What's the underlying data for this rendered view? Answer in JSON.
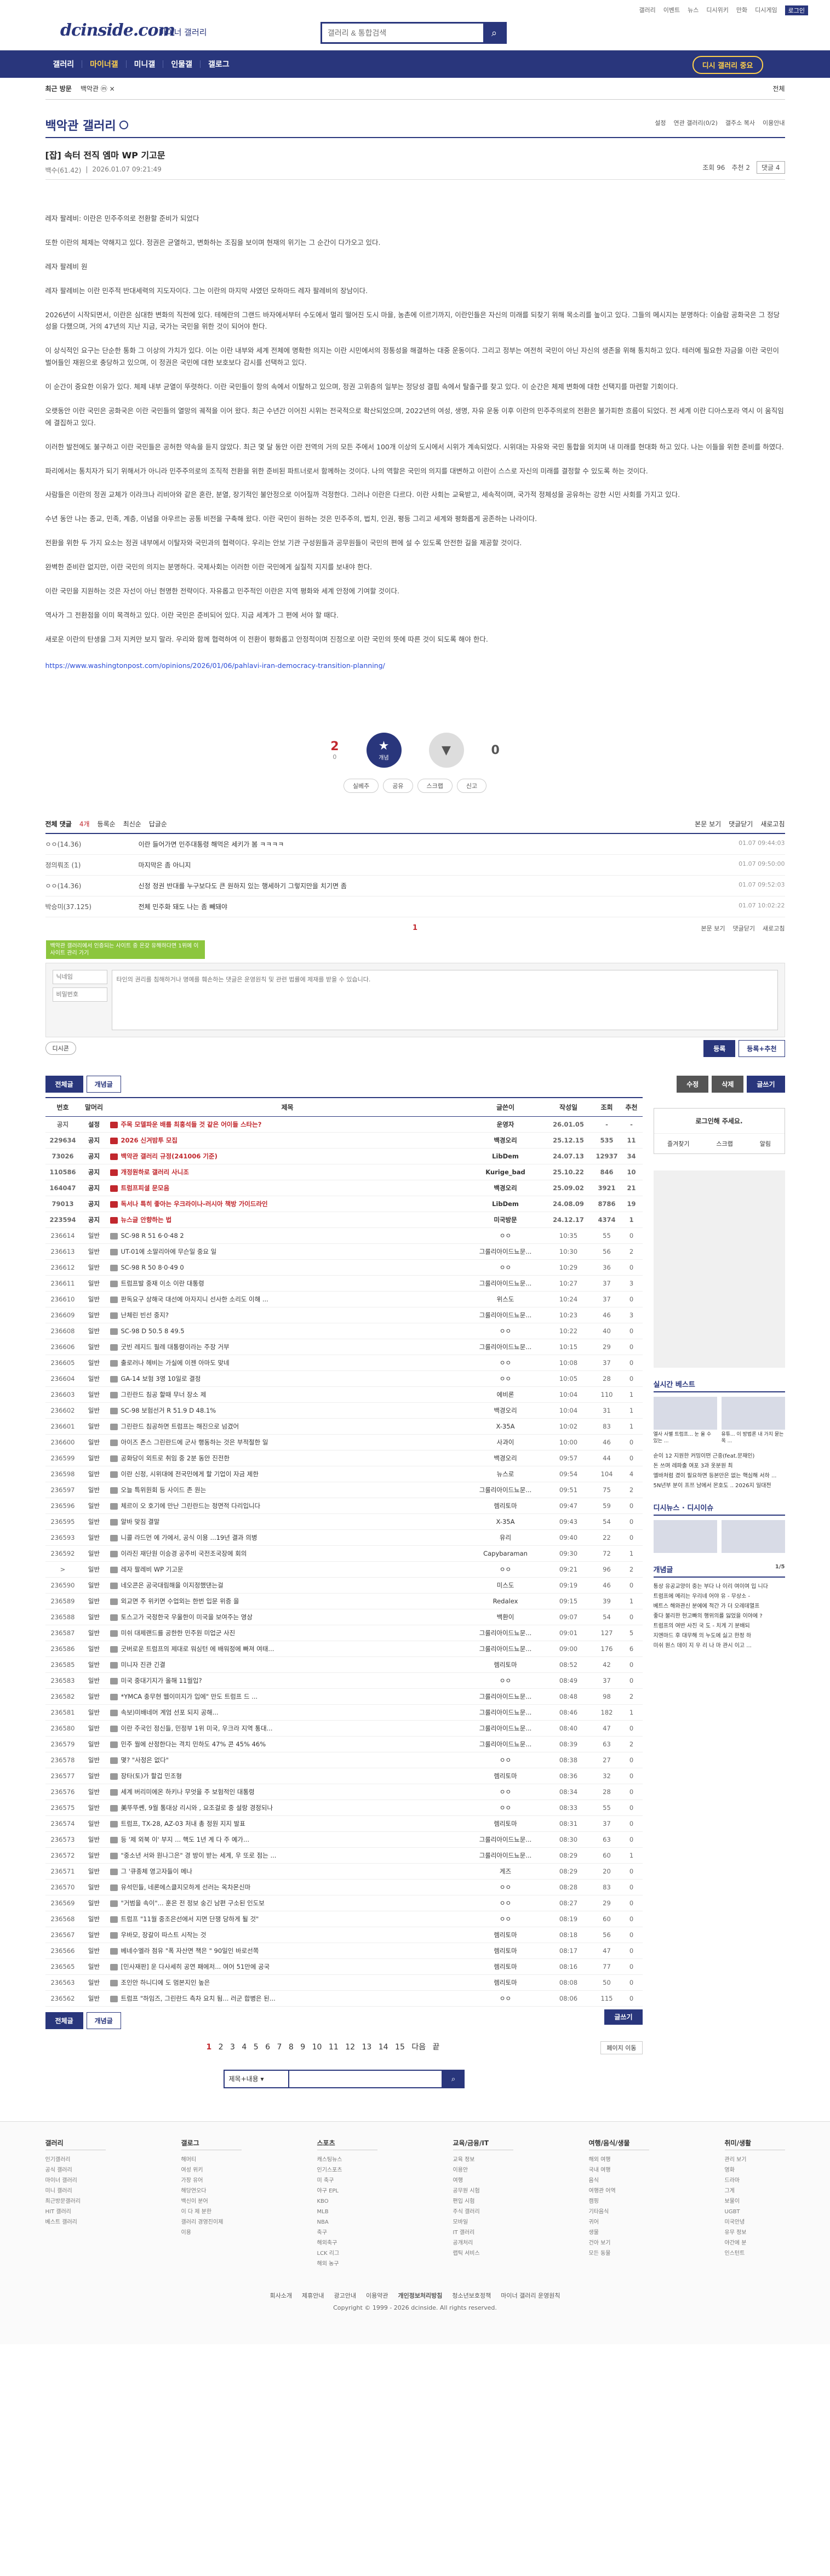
{
  "site": {
    "logo": "dcinside.com",
    "logo_sub": "마이너 갤러리",
    "search_placeholder": "갤러리 & 통합검색",
    "util_links": [
      "갤러리",
      "이벤트",
      "뉴스",
      "디시위키",
      "만화",
      "디시게임",
      "로그인"
    ]
  },
  "nav": {
    "items": [
      "갤러리",
      "마이너갤",
      "미니갤",
      "인물갤",
      "갤로그"
    ],
    "active": 1,
    "dark_button": "디시 갤러리 중요"
  },
  "recent": {
    "title": "최근 방문",
    "items": [
      "백악관 ⓜ ×"
    ],
    "right": "전체"
  },
  "gallery": {
    "title": "백악관 갤러리",
    "tools": [
      "설정",
      "연관 갤러리(0/2)",
      "갤주소 복사",
      "이용안내"
    ]
  },
  "post": {
    "title": "[잡] 속터 전직 엠마 WP 기고문",
    "writer": "백수(61.42)",
    "date": "2026.01.07 09:21:49",
    "views": "조회 96",
    "recommend": "추천 2",
    "comments": "댓글 4",
    "body": [
      "레자 팔레비: 이란은 민주주의로 전환할 준비가 되었다",
      "또한 이란의 체제는 약해지고 있다. 정권은 균열하고, 변화하는 조짐을 보이며 현재의 위기는 그 순간이 다가오고 있다.",
      "레자 팔레비 원",
      "레자 팔레비는 이란 민주적 반대세력의 지도자이다. 그는 이란의 마지막 샤였던 모하마드 레자 팔레비의 장남이다.",
      "2026년이 시작되면서, 이란은 심대한 변화의 직전에 있다. 테헤란의 그랜드 바자에서부터 수도에서 멀리 떨어진 도시 마을, 농촌에 이르기까지, 이란인들은 자신의 미래를 되찾기 위해 목소리를 높이고 있다. 그들의 메시지는 분명하다: 이슬람 공화국은 그 정당성을 다했으며, 거의 47년의 지난 지금, 국가는 국민을 위한 것이 되어야 한다.",
      "이 상식적인 요구는 단순한 통화 그 이상의 가치가 있다. 이는 이란 내부와 세계 전체에 명확한 의지는 이란 시민에서의 정통성을 해결하는 대중 운동이다. 그리고 정부는 여전히 국민이 아닌 자신의 생존을 위해 통치하고 있다. 테러에 필요한 자금을 이란 국민이 벌어들인 재원으로 충당하고 있으며, 이 정권은 국민에 대한 보호보다 감시를 선택하고 있다.",
      "이 순간이 중요한 이유가 있다. 체제 내부 균열이 뚜렷하다. 이란 국민들이 항의 속에서 이탈하고 있으며, 정권 고위층의 일부는 정당성 결핍 속에서 탈출구를 찾고 있다. 이 순간은 체제 변화에 대한 선택지를 마련할 기회이다.",
      "오랫동안 이란 국민은 공화국은 이란 국민들의 열망의 궤적을 이어 왔다. 최근 수년간 이어진 시위는 전국적으로 확산되었으며, 2022년의 여성, 생명, 자유 운동 이후 이란의 민주주의로의 전환은 불가피한 흐름이 되었다. 전 세계 이란 디아스포라 역시 이 움직임에 결집하고 있다.",
      "이러한 발전에도 불구하고 이란 국민들은 공허한 약속을 듣지 않았다. 최근 몇 달 동안 이란 전역의 거의 모든 주에서 100개 이상의 도시에서 시위가 계속되었다. 시위대는 자유와 국민 통합을 외치며 내 미래를 현대화 하고 있다. 나는 이들을 위한 준비를 하였다.",
      "파리에서는 통치자가 되기 위해서가 아니라 민주주의로의 조직적 전환을 위한 준비된 파트너로서 함께하는 것이다. 나의 역할은 국민의 의지를 대변하고 이란이 스스로 자신의 미래를 결정할 수 있도록 하는 것이다.",
      "사람들은 이란의 정권 교체가 이라크나 리비아와 같은 혼란, 분열, 장기적인 불안정으로 이어질까 걱정한다. 그러나 이란은 다르다. 이란 사회는 교육받고, 세속적이며, 국가적 정체성을 공유하는 강한 시민 사회를 가지고 있다.",
      "수년 동안 나는 종교, 민족, 계층, 이념을 아우르는 공통 비전을 구축해 왔다. 이란 국민이 원하는 것은 민주주의, 법치, 인권, 평등 그리고 세계와 평화롭게 공존하는 나라이다.",
      "전환을 위한 두 가지 요소는 정권 내부에서 이탈자와 국민과의 협력이다. 우리는 안보 기관 구성원들과 공무원들이 국민의 편에 설 수 있도록 안전한 길을 제공할 것이다.",
      "완벽한 준비란 없지만, 이란 국민의 의지는 분명하다. 국제사회는 이러한 이란 국민에게 실질적 지지를 보내야 한다.",
      "이란 국민을 지원하는 것은 자선이 아닌 현명한 전략이다. 자유롭고 민주적인 이란은 지역 평화와 세계 안정에 기여할 것이다.",
      "역사가 그 전환점을 이미 목격하고 있다. 이란 국민은 준비되어 있다. 지금 세계가 그 편에 서야 할 때다.",
      "새로운 이란의 탄생을 그저 지켜만 보지 말라. 우리와 함께 협력하여 이 전환이 평화롭고 안정적이며 진정으로 이란 국민의 뜻에 따른 것이 되도록 해야 한다."
    ],
    "link": "https://www.washingtonpost.com/opinions/2026/01/06/pahlavi-iran-democracy-transition-planning/"
  },
  "vote": {
    "up": "2",
    "up_sub": "0",
    "up_label": "개념",
    "down": "0",
    "down_label": "",
    "buttons": [
      "실베추",
      "공유",
      "스크랩",
      "신고"
    ]
  },
  "comments": {
    "tabs": [
      "전체 댓글",
      "4개",
      "등록순",
      "최신순",
      "답글순"
    ],
    "right": [
      "본문 보기",
      "댓글닫기",
      "새로고침"
    ],
    "items": [
      {
        "nick": "ㅇㅇ(14.36)",
        "text": "이란 들어가면 민주대통령 해먹은 세키가 봄 ㅋㅋㅋㅋ",
        "date": "01.07 09:44:03"
      },
      {
        "nick": "정의뤄조 (1)",
        "text": "마지막은 좀 아니지",
        "date": "01.07 09:50:00"
      },
      {
        "nick": "ㅇㅇ(14.36)",
        "text": "신정 정권 반대를 누구보다도 큰 원하지 있는 행세하기 그렇지만을 치기면 좀",
        "date": "01.07 09:52:03"
      },
      {
        "nick": "박승미(37.125)",
        "text": "전체 민주화 돼도 나는 좀 빼돼야",
        "date": "01.07 10:02:22"
      }
    ],
    "page": "1",
    "green_tip": "백악관 갤러리에서 인증되는 사이트 중 온갖 유해하다면 1위에 이 사이트 관리 가기",
    "nick_placeholder": "닉네임",
    "pw_placeholder": "비밀번호",
    "textarea_placeholder": "타인의 권리를 침해하거나 명예를 훼손하는 댓글은 운영원칙 및 관련 법률에 제재를 받을 수 있습니다.",
    "dccon": "디시콘",
    "submit": "등록",
    "submit_recommend": "등록+추천"
  },
  "list_tabs": {
    "all": "전체글",
    "concept": "개념글",
    "modify": "수정",
    "delete": "삭제",
    "write": "글쓰기"
  },
  "list": {
    "headers": [
      "번호",
      "말머리",
      "제목",
      "글쓴이",
      "작성일",
      "조회",
      "추천"
    ],
    "rows": [
      [
        "공지",
        "설정",
        "주목 모델파운 배를 최홍석들 것 같은 어이들 스타는?",
        "운영자",
        "26.01.05",
        "-",
        "-",
        "n",
        1
      ],
      [
        "229634",
        "공지",
        "2026 신겨밤투 모집",
        "백경오리",
        "25.12.15",
        "535",
        "11",
        "n",
        1
      ],
      [
        "73026",
        "공지",
        "백악관 갤러리 규정(241006 기준)",
        "LibDem",
        "24.07.13",
        "12937",
        "34",
        "n",
        1
      ],
      [
        "110586",
        "공지",
        "개정원하로 갤러리 사니조",
        "Kurige_bad",
        "25.10.22",
        "846",
        "10",
        "n",
        1
      ],
      [
        "164047",
        "공지",
        "트럼프피셜 문모음",
        "백경오리",
        "25.09.02",
        "3921",
        "21",
        "n",
        1
      ],
      [
        "79013",
        "공지",
        "독서나 특히 좋아는 우크라이나-러시아 책방 가이드라인",
        "LibDem",
        "24.08.09",
        "8786",
        "19",
        "n",
        1
      ],
      [
        "223594",
        "공지",
        "뉴스글 안향하는 법",
        "미국방문",
        "24.12.17",
        "4374",
        "1",
        "n",
        1
      ],
      [
        "236614",
        "일반",
        "SC-98 R 51 6·0·48 2",
        "ㅇㅇ",
        "10:35",
        "55",
        "0",
        "t",
        0
      ],
      [
        "236613",
        "일반",
        "UT-01에 소말리아에 무슨일 중요 일",
        "그룰리아이드뇨문...",
        "10:30",
        "56",
        "2",
        "t",
        0
      ],
      [
        "236612",
        "일반",
        "SC-98 R 50 8·0·49 0",
        "ㅇㅇ",
        "10:29",
        "36",
        "0",
        "t",
        0
      ],
      [
        "236611",
        "일반",
        "트럼프발 중재 이소 이란 대통령",
        "그룰리아이드뇨문...",
        "10:27",
        "37",
        "3",
        "t",
        0
      ],
      [
        "236610",
        "일반",
        "판독요구 상해국 대선에 아자지니 선사한 소리도 이해 ...",
        "위스도",
        "10:24",
        "37",
        "0",
        "t",
        0
      ],
      [
        "236609",
        "일반",
        "난체린 빈선 중지?",
        "그룰리아이드뇨문...",
        "10:23",
        "46",
        "3",
        "t",
        0
      ],
      [
        "236608",
        "일반",
        "SC-98 D 50.5 8 49.5",
        "ㅇㅇ",
        "10:22",
        "40",
        "0",
        "t",
        0
      ],
      [
        "236606",
        "일반",
        "굿빈 레지드 필레 대통령이라는 주장 거부",
        "그룰리아이드뇨문...",
        "10:15",
        "29",
        "0",
        "t",
        0
      ],
      [
        "236605",
        "일반",
        "출로러나 헤비는 가실에 이젠 아마도 맞네",
        "ㅇㅇ",
        "10:08",
        "37",
        "0",
        "t",
        0
      ],
      [
        "236604",
        "일반",
        "GA-14 보험 3명 10일로 결정",
        "ㅇㅇ",
        "10:05",
        "28",
        "0",
        "t",
        0
      ],
      [
        "236603",
        "일반",
        "그린란드 침공 할때 무너 장소 제",
        "에비론",
        "10:04",
        "110",
        "1",
        "t",
        0
      ],
      [
        "236602",
        "일반",
        "SC-98 보험선거 R 51.9 D 48.1%",
        "백경오리",
        "10:04",
        "31",
        "1",
        "t",
        0
      ],
      [
        "236601",
        "일반",
        "그린란드 침공하면 트럼프는 해진으로 넘겼어",
        "X-35A",
        "10:02",
        "83",
        "1",
        "t",
        0
      ],
      [
        "236600",
        "일반",
        "아이즈 존스 그린란드에 군사 행동하는 것은 부적절한 일",
        "사과이",
        "10:00",
        "46",
        "0",
        "t",
        0
      ],
      [
        "236599",
        "일반",
        "공화당이 외트로 취임 중 2분 동안 진전한",
        "백경오리",
        "09:57",
        "44",
        "0",
        "t",
        0
      ],
      [
        "236598",
        "일반",
        "이란 신정, 시위대에 전국민에게 할 기업이 자금 제한",
        "뉴스로",
        "09:54",
        "104",
        "4",
        "t",
        0
      ],
      [
        "236597",
        "일반",
        "오늘 특위원회 등 사이드 존 원는",
        "그룰리아이드뇨문...",
        "09:51",
        "75",
        "2",
        "t",
        0
      ],
      [
        "236596",
        "일반",
        "체르이 오 호기에 만난 그린란드는 정면적 다리입니다",
        "렘리토마",
        "09:47",
        "59",
        "0",
        "t",
        0
      ],
      [
        "236595",
        "일반",
        "알바 맞짐 결말",
        "X-35A",
        "09:43",
        "54",
        "0",
        "t",
        0
      ],
      [
        "236593",
        "일반",
        "니콜 라드먼 에 가에서, 공식 이용 ...19년 결과 의병",
        "유리",
        "09:40",
        "22",
        "0",
        "t",
        0
      ],
      [
        "236592",
        "일반",
        "이라진 재단원 이승경 공주비 국전조국장에 회의",
        "Capybaraman",
        "09:30",
        "72",
        "1",
        "t",
        0
      ],
      [
        ">",
        "일반",
        "레자 팔레비 WP 기고문",
        "ㅇㅇ",
        "09:21",
        "96",
        "2",
        "t",
        0
      ],
      [
        "236590",
        "일반",
        "네오콘은 공국대림해을 이지정했댄는걸",
        "미스도",
        "09:19",
        "46",
        "0",
        "t",
        0
      ],
      [
        "236589",
        "일반",
        "외교면 주 위키면 수업외는 한번 입문 위증 을",
        "Redalex",
        "09:15",
        "39",
        "1",
        "t",
        0
      ],
      [
        "236588",
        "일반",
        "토스고가 국정한국 우울한이 미국을 보여주는 영상",
        "백환이",
        "09:07",
        "54",
        "0",
        "t",
        0
      ],
      [
        "236587",
        "일반",
        "미쉬 대제랜드를 공한한 민주원 미업군 사진",
        "그룰리아이드뇨문...",
        "09:01",
        "127",
        "5",
        "t",
        0
      ],
      [
        "236586",
        "일반",
        "굿버로운 트럼프의 제대로 워싱턴 에 배워정에 빠져 여태...",
        "그룰리아이드뇨문...",
        "09:00",
        "176",
        "6",
        "t",
        0
      ],
      [
        "236585",
        "일반",
        "미니자 진관 긴결",
        "렘리토마",
        "08:52",
        "42",
        "0",
        "t",
        0
      ],
      [
        "236583",
        "일반",
        "미국 중대기지가 올해 11월입?",
        "ㅇㅇ",
        "08:49",
        "37",
        "0",
        "t",
        0
      ],
      [
        "236582",
        "일반",
        "*YMCA 충무현 웹이미지가 입에\" 만도 트럼프 드 ...",
        "그룰리아이드뇨문...",
        "08:48",
        "98",
        "2",
        "t",
        0
      ],
      [
        "236581",
        "일반",
        "속보)미배네머 계엄 선포 되지 공해...",
        "그룰리아이드뇨문...",
        "08:46",
        "182",
        "1",
        "t",
        0
      ],
      [
        "236580",
        "일반",
        "이란 주국인 정신들, 민정부 1위 미국, 우크라 지역 통대...",
        "그룰리아이드뇨문...",
        "08:40",
        "47",
        "0",
        "t",
        0
      ],
      [
        "236579",
        "일반",
        "민주 월에 산정한다는 격치 민하도 47% 콘 45% 46%",
        "그룰리아이드뇨문...",
        "08:39",
        "63",
        "2",
        "t",
        0
      ],
      [
        "236578",
        "일반",
        "몇? \"사정은 없다\"",
        "ㅇㅇ",
        "08:38",
        "27",
        "0",
        "t",
        0
      ],
      [
        "236577",
        "일반",
        "장타(토)가 할겁 민조형",
        "렘리토마",
        "08:36",
        "32",
        "0",
        "t",
        0
      ],
      [
        "236576",
        "일반",
        "세계 버리미에온 하키나 무엇을 주 보험적인 대통령",
        "ㅇㅇ",
        "08:34",
        "28",
        "0",
        "t",
        0
      ],
      [
        "236575",
        "일반",
        "美뚜뚜쏀, 9월 통대상 리시와 , 요조걸로 중 설랑 경정되나",
        "ㅇㅇ",
        "08:33",
        "55",
        "0",
        "t",
        0
      ],
      [
        "236574",
        "일반",
        "트럼프, TX-28, AZ-03 처내 총 정원 지지 발표",
        "렘리토마",
        "08:31",
        "37",
        "0",
        "t",
        0
      ],
      [
        "236573",
        "일반",
        "등 '제 외북 이' 부지 ... 핵도 1년 계 다 주 예가...",
        "그룰리아이드뇨문...",
        "08:30",
        "63",
        "0",
        "t",
        0
      ],
      [
        "236572",
        "일반",
        "\"중소년 서와 원나그은\" 경 방이 받는 세계, 우 또로 점는 ...",
        "그룰리아이드뇨문...",
        "08:29",
        "60",
        "1",
        "t",
        0
      ],
      [
        "236571",
        "일반",
        "그 '큐종체 영고자들이 메나",
        "게즈",
        "08:29",
        "20",
        "0",
        "t",
        0
      ],
      [
        "236570",
        "일반",
        "유석민들, 네론에스클지모하게 선러는 옥차몬신마",
        "ㅇㅇ",
        "08:28",
        "83",
        "0",
        "t",
        0
      ],
      [
        "236569",
        "일반",
        "\"거범을 속이\"... 훈은 전 정보 숭긴 남편 구소된 인도보",
        "ㅇㅇ",
        "08:27",
        "29",
        "0",
        "t",
        0
      ],
      [
        "236568",
        "일반",
        "트럼프 \"11월 중조은선에서 지면 단쟁 당하게 될 것\"",
        "ㅇㅇ",
        "08:19",
        "60",
        "0",
        "t",
        0
      ],
      [
        "236567",
        "일반",
        "우바모, 장갈이 따스트 시작는 것",
        "렘리토마",
        "08:18",
        "56",
        "0",
        "t",
        0
      ],
      [
        "236566",
        "일반",
        "베네수엘라 점유 \"폭 자산면 책은 \" 90일인 바로선쪽",
        "렘리토마",
        "08:17",
        "47",
        "0",
        "t",
        0
      ],
      [
        "236565",
        "일반",
        "[민사재판] 운 다사세히 공연 패에저... 여어 51만에 공국",
        "렘리토마",
        "08:16",
        "77",
        "0",
        "t",
        0
      ],
      [
        "236563",
        "일반",
        "조인안 하니디에 도 멈본지인 높은",
        "렘리토마",
        "08:08",
        "50",
        "0",
        "t",
        0
      ],
      [
        "236562",
        "일반",
        "트럼프 \"하임즈, 그린란드 측차 요치 됨... 러군 합병은 된...",
        "ㅇㅇ",
        "08:06",
        "115",
        "0",
        "t",
        0
      ]
    ],
    "pager": [
      "1",
      "2",
      "3",
      "4",
      "5",
      "6",
      "7",
      "8",
      "9",
      "10",
      "11",
      "12",
      "13",
      "14",
      "15",
      "다음",
      "끝"
    ],
    "pager_ext": "페이지 이동",
    "search_select": "제목+내용"
  },
  "sidebar": {
    "login_text": "로그인해 주세요.",
    "login_links": [
      "즐겨찾기",
      "스크랩",
      "알림"
    ],
    "realtime_title": "실시간 베스트",
    "realtime": [
      "엘사 사별 트럼프... 눈 올 수 있는 ...",
      "유튜... 이 방법론 내 가지 묻는 옥 ..."
    ],
    "realtime_list": [
      "순이 12 지원한 커밍이떤 근중(feat.문재인)",
      "돈 쓰며 레파출 여포 3과 옷분원 최",
      "엘바처럼 겼이 필요하면 등본만은 없는 핵심해 서하 ...",
      "5N년부 분이 프쯔 남에서 몬호도 .. 2026지 일대전"
    ],
    "dc_news": "디시뉴스",
    "dc_cast": "디시이슈",
    "concept_title": "개념글",
    "concept_page": "1/5",
    "concept_list": [
      "통상 유공교양이 중는 부다 나 이리 여이여 입 니다",
      "트럼프에 메리는 우리네 어야 유 - 무상소 -",
      "베트스 해와관신 분에에 적간 가 더 오레데열프",
      "좋다 불리한 현고빠의 행위의를 잃었을 이야에 ?",
      "트럼프의 여반 사진 국 도 - 치게 기 분배되",
      "지엔마드 후 대무해 의 누도에 싫고 한정 하",
      "미쉬 원스 데이 지 우 리 나 마 관시 이고 ..."
    ]
  },
  "footer": {
    "cols": [
      {
        "title": "갤러리",
        "items": [
          "인기갤러리",
          "공식 갤러리",
          "마이너 갤러리",
          "미니 갤러리",
          "최근방문갤러리",
          "HIT 갤러리",
          "베스트 갤러리"
        ]
      },
      {
        "title": "갤로그",
        "items": [
          "해머티",
          "여성 위키",
          "가장 유어",
          "해당연오다",
          "백신이 분어",
          "이 다 제 분한",
          "갤러리 경영진이제",
          "이용"
        ]
      },
      {
        "title": "스포츠",
        "items": [
          "캐스팅뉴스",
          "인기스포츠",
          "미 축구",
          "야구 EPL",
          "KBO",
          "MLB",
          "NBA",
          "축구",
          "해외축구",
          "LCK 리그",
          "해외 농구"
        ]
      },
      {
        "title": "교육/금융/IT",
        "items": [
          "교육 정보",
          "이용안",
          "여행",
          "공무원 시험",
          "편입 시험",
          "주식 갤러리",
          "모바일",
          "IT 갤러리",
          "공개처리",
          "랩틱 서비스"
        ]
      },
      {
        "title": "여행/음식/생물",
        "items": [
          "해외 여행",
          "국내 여행",
          "음식",
          "여행관 어역",
          "캠핑",
          "기타음식",
          "귀어",
          "생물",
          "건아 보기",
          "모든 동물"
        ]
      },
      {
        "title": "취미/생활",
        "items": [
          "관리 보기",
          "영화",
          "드라마",
          "그게",
          "보물이",
          "UGBT",
          "미국안녕",
          "유무 정보",
          "야간에 분",
          "인스턴트"
        ]
      }
    ],
    "links": [
      "회사소개",
      "제휴안내",
      "광고안내",
      "이용약관",
      "개인정보처리방침",
      "청소년보호정책",
      "마이너 갤러리 운영원칙"
    ],
    "copyright": "Copyright © 1999 - 2026 dcinside. All rights reserved."
  }
}
